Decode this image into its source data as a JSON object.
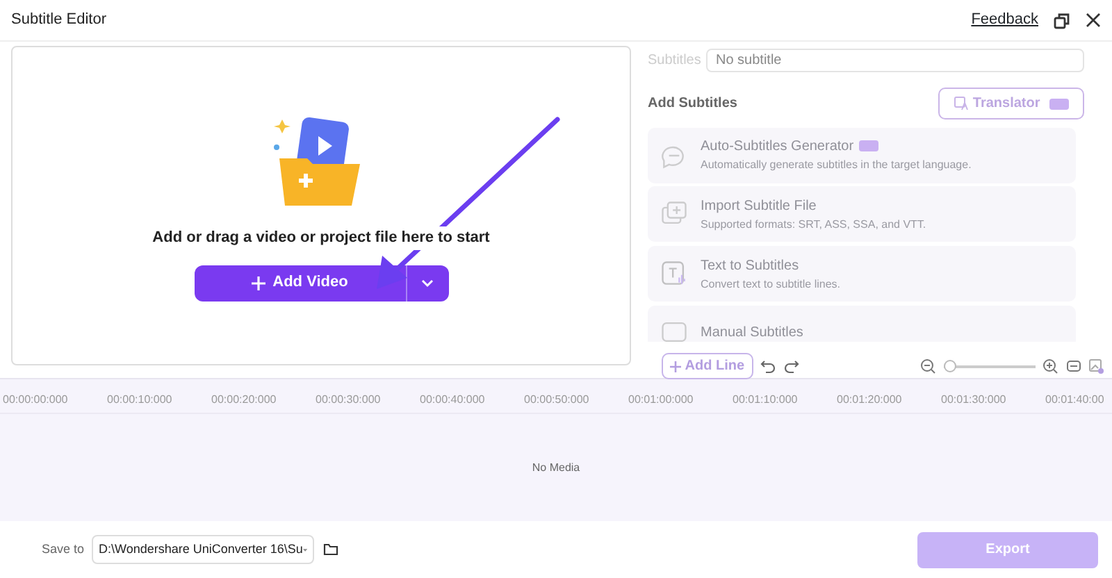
{
  "window": {
    "title": "Subtitle Editor",
    "feedback_link": "Feedback"
  },
  "drop_area": {
    "prompt": "Add or drag a video or project file here to start",
    "add_button": "Add Video"
  },
  "subtitles_field": {
    "label": "Subtitles",
    "value": "No subtitle"
  },
  "add_subtitles": {
    "heading": "Add Subtitles",
    "translator_button": "Translator",
    "options": [
      {
        "kind": "auto",
        "title": "Auto-Subtitles Generator",
        "description": "Automatically generate subtitles in the target language.",
        "premium": true,
        "disabled": true
      },
      {
        "kind": "import",
        "title": "Import Subtitle File",
        "description": "Supported formats: SRT, ASS, SSA, and VTT.",
        "premium": false,
        "disabled": true
      },
      {
        "kind": "text",
        "title": "Text to Subtitles",
        "description": "Convert text to subtitle lines.",
        "premium": false,
        "disabled": true
      },
      {
        "kind": "manual",
        "title": "Manual Subtitles",
        "premium": false,
        "disabled": true
      }
    ]
  },
  "toolbar": {
    "add_line_button": "Add Line",
    "zoom": {
      "level": 0
    }
  },
  "timeline": {
    "ticks": [
      "00:00:00:000",
      "00:00:10:000",
      "00:00:20:000",
      "00:00:30:000",
      "00:00:40:000",
      "00:00:50:000",
      "00:01:00:000",
      "00:01:10:000",
      "00:01:20:000",
      "00:01:30:000",
      "00:01:40:00"
    ],
    "empty_text": "No Media"
  },
  "footer": {
    "save_to_label": "Save to",
    "path": "D:\\Wondershare UniConverter 16\\Su",
    "export_button": "Export",
    "export_disabled": true
  }
}
